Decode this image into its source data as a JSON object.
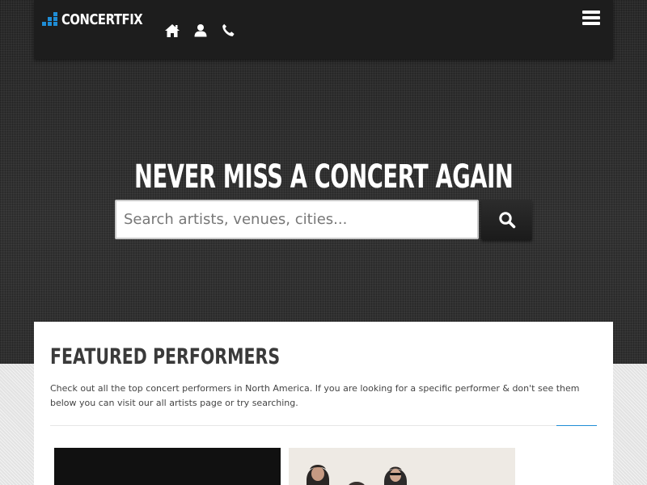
{
  "header": {
    "logo_text": "CONCERTFIX",
    "nav_icons": [
      "home-icon",
      "user-icon",
      "phone-icon"
    ],
    "menu_icon": "hamburger-menu-icon"
  },
  "hero": {
    "title": "NEVER MISS A CONCERT AGAIN",
    "search_placeholder": "Search artists, venues, cities...",
    "search_icon": "search-icon"
  },
  "featured": {
    "title": "FEATURED PERFORMERS",
    "description": "Check out all the top concert performers in North America. If you are looking for a specific performer & don't see them below you can visit our all artists page or try searching."
  },
  "colors": {
    "accent": "#1f8dd6",
    "navbar_bg": "#1d1d1d",
    "hero_bg": "#2e2e2e",
    "content_bg": "#ffffff"
  }
}
